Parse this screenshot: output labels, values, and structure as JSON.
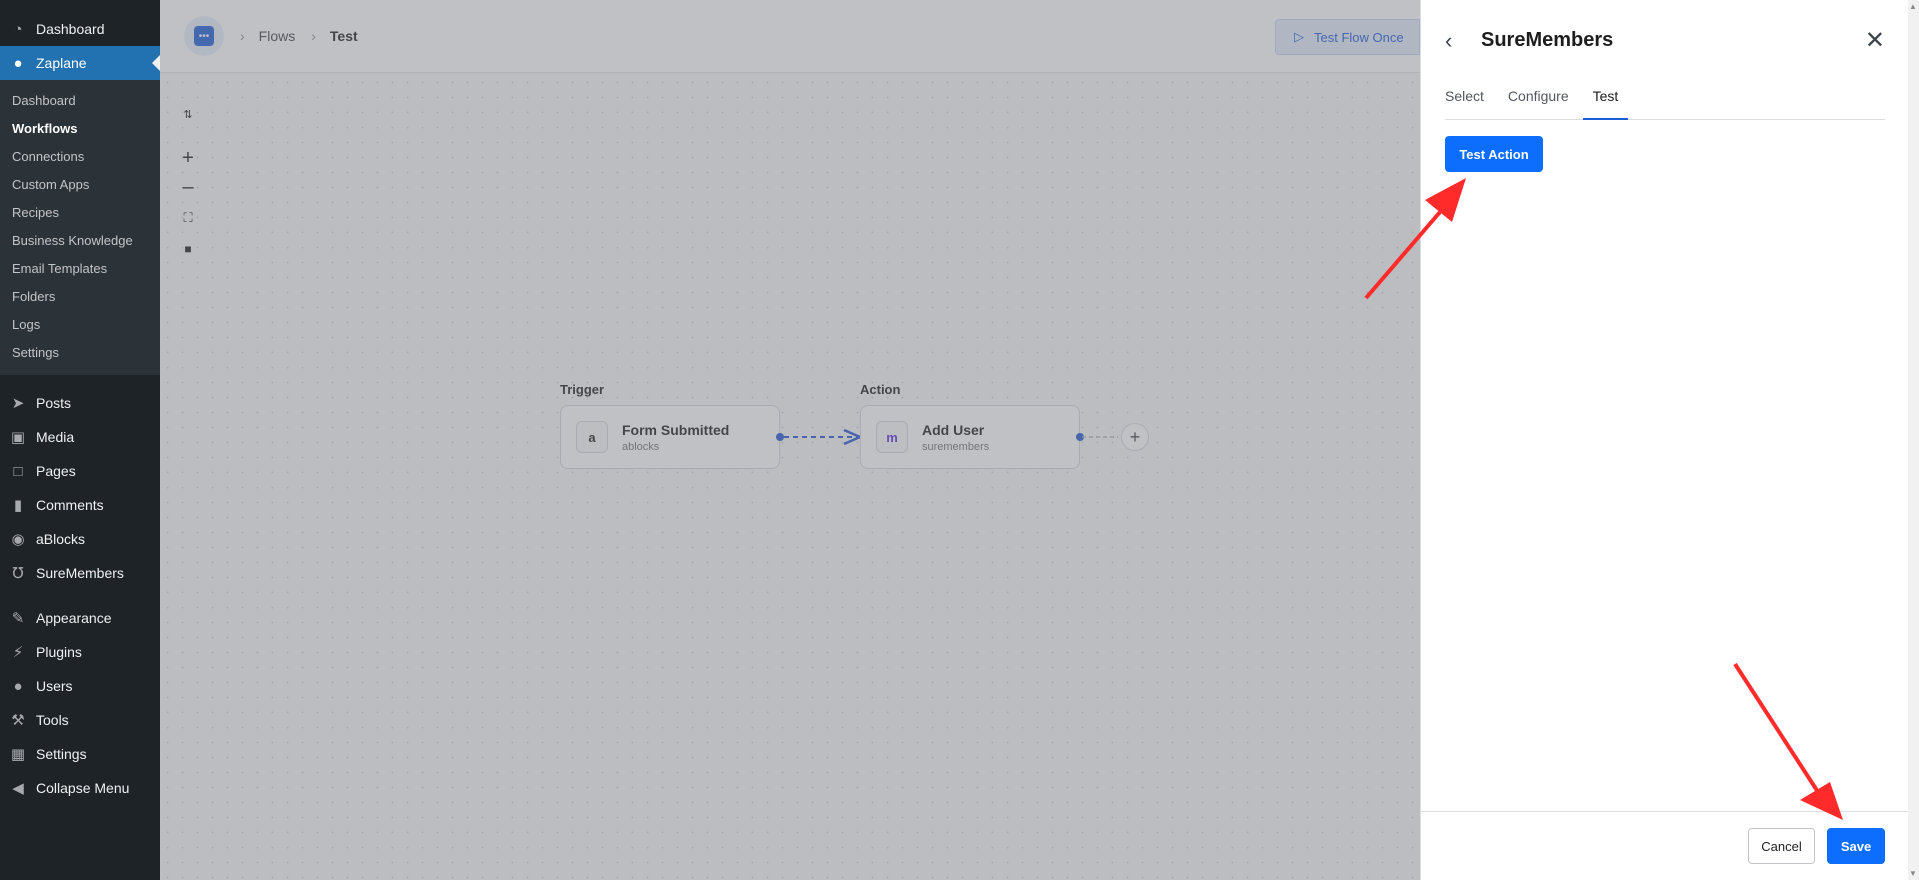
{
  "sidebar": {
    "top_items": [
      {
        "label": "Dashboard",
        "icon": "dashboard-icon"
      },
      {
        "label": "Zaplane",
        "icon": "zaplane-icon"
      }
    ],
    "submenu": [
      "Dashboard",
      "Workflows",
      "Connections",
      "Custom Apps",
      "Recipes",
      "Business Knowledge",
      "Email Templates",
      "Folders",
      "Logs",
      "Settings"
    ],
    "items": [
      {
        "label": "Posts",
        "icon": "pin-icon"
      },
      {
        "label": "Media",
        "icon": "media-icon"
      },
      {
        "label": "Pages",
        "icon": "pages-icon"
      },
      {
        "label": "Comments",
        "icon": "comment-icon"
      },
      {
        "label": "aBlocks",
        "icon": "ablocks-icon"
      },
      {
        "label": "SureMembers",
        "icon": "suremembers-icon"
      },
      {
        "label": "Appearance",
        "icon": "brush-icon"
      },
      {
        "label": "Plugins",
        "icon": "plugin-icon"
      },
      {
        "label": "Users",
        "icon": "user-icon"
      },
      {
        "label": "Tools",
        "icon": "wrench-icon"
      },
      {
        "label": "Settings",
        "icon": "settings-icon"
      },
      {
        "label": "Collapse Menu",
        "icon": "collapse-icon"
      }
    ]
  },
  "header": {
    "breadcrumb": [
      "Flows",
      "Test"
    ],
    "test_flow_label": "Test Flow Once"
  },
  "flow": {
    "trigger": {
      "heading": "Trigger",
      "title": "Form Submitted",
      "app": "ablocks"
    },
    "action": {
      "heading": "Action",
      "title": "Add User",
      "app": "suremembers"
    }
  },
  "panel": {
    "title": "SureMembers",
    "tabs": [
      "Select",
      "Configure",
      "Test"
    ],
    "active_tab": "Test",
    "test_action_label": "Test Action",
    "cancel_label": "Cancel",
    "save_label": "Save"
  },
  "colors": {
    "accent": "#0d6efd",
    "sidebar_bg": "#1d2327",
    "sidebar_current": "#2271b1",
    "annotation_arrow": "#ff2a2a"
  }
}
